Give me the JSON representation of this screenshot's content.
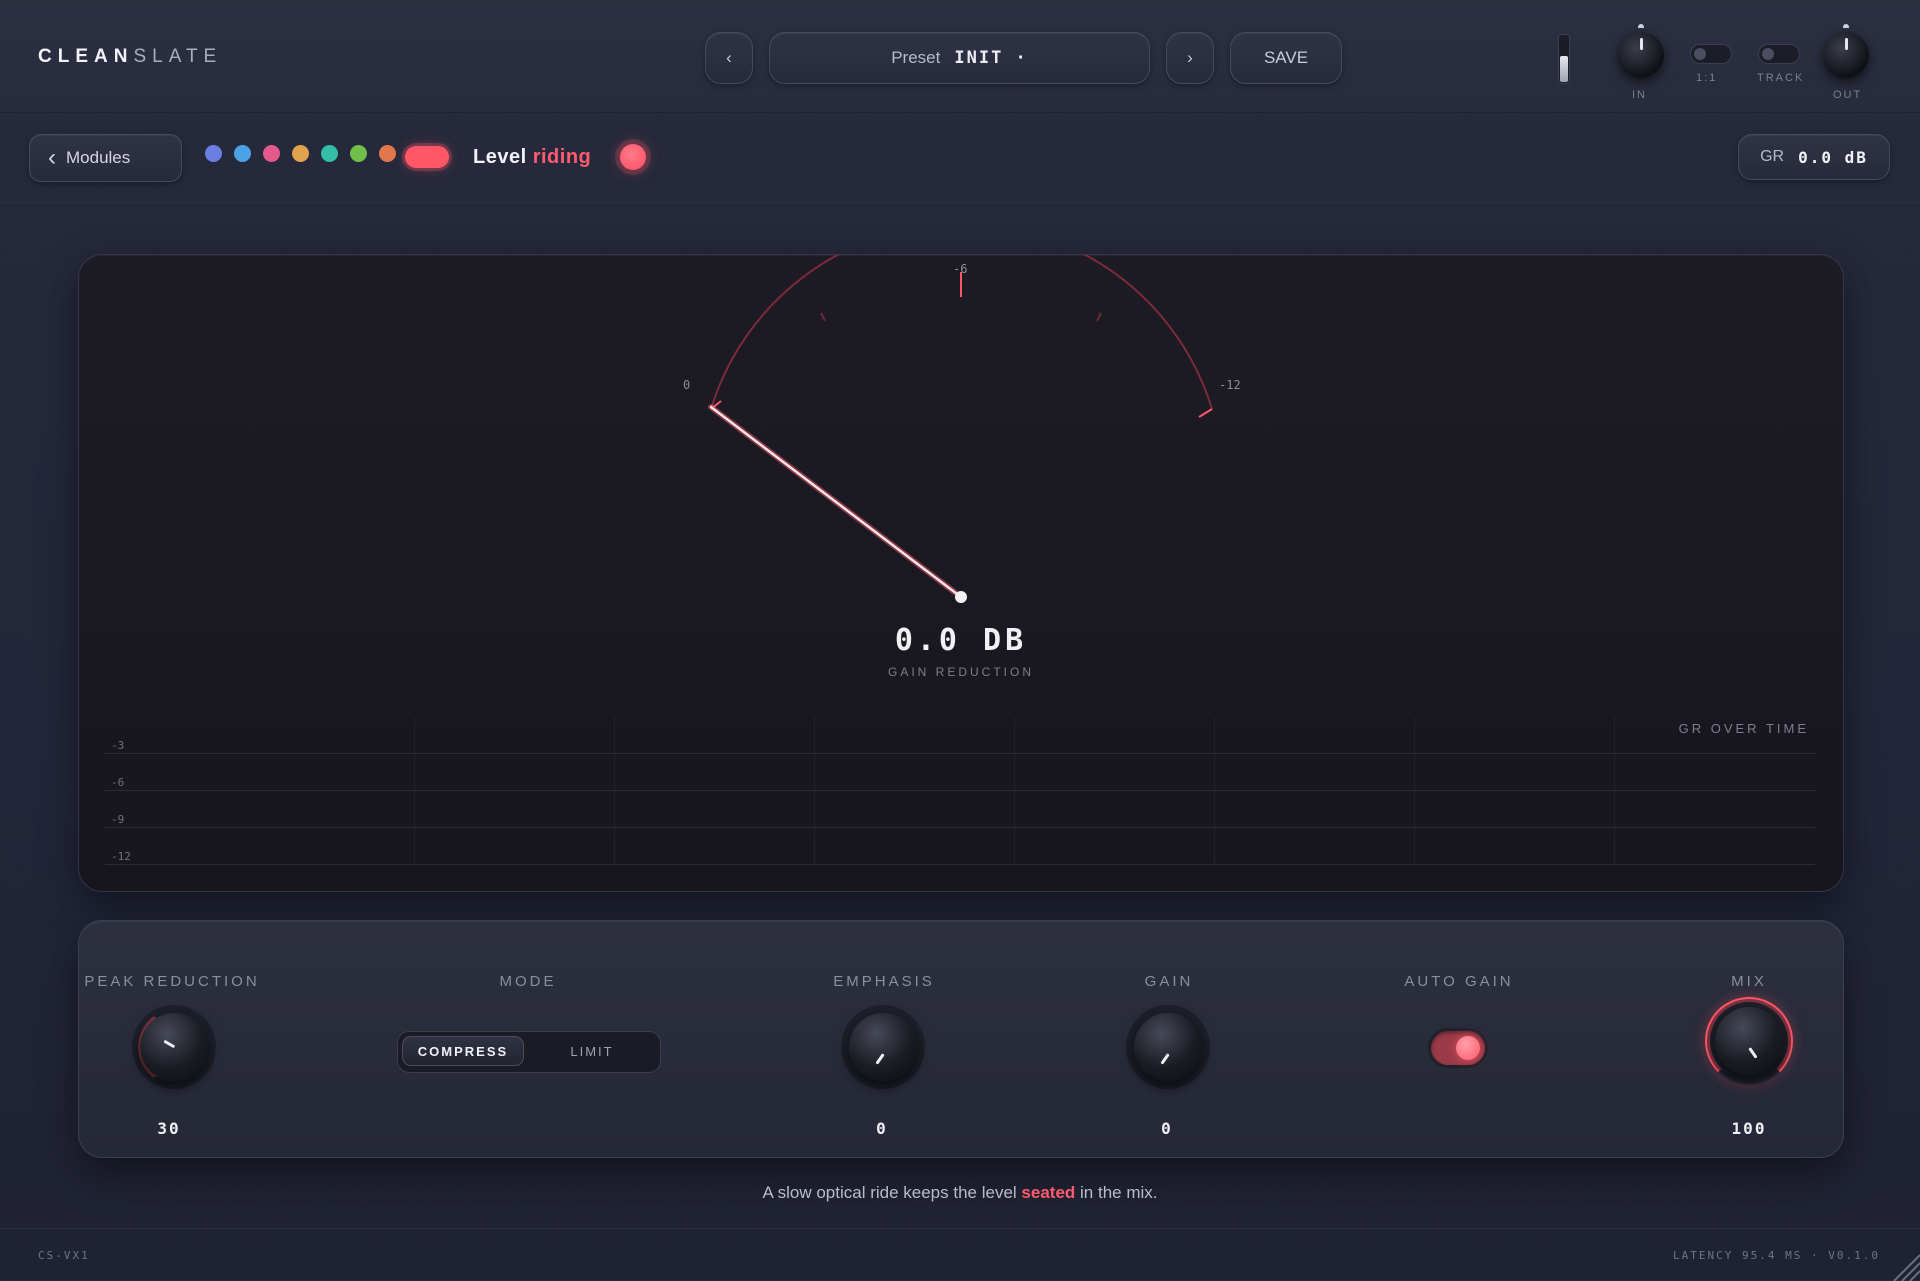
{
  "brand": {
    "bold": "CLEAN",
    "light": "SLATE"
  },
  "header": {
    "prev_label": "‹",
    "next_label": "›",
    "preset_label": "Preset",
    "preset_value": "INIT ·",
    "save_label": "SAVE",
    "input_meter_level": 0.55,
    "knob_in_label": "IN",
    "switch_ratio_label": "1:1",
    "switch_track_label": "TRACK",
    "knob_out_label": "OUT"
  },
  "modulebar": {
    "modules_label": "Modules",
    "color_dots": [
      "#6b7fe0",
      "#4ba3e6",
      "#e25a8a",
      "#e0a24c",
      "#34bda8",
      "#6fbf4a",
      "#e0784c"
    ],
    "active_color": "#ff5668",
    "title_main": "Level",
    "title_accent": "riding",
    "gr_label": "GR",
    "gr_value": "0.0 dB"
  },
  "meter": {
    "scale_left": "0",
    "scale_top": "-6",
    "scale_right": "-12",
    "readout": "0.0 DB",
    "caption": "GAIN REDUCTION",
    "accent_color": "#ff5668"
  },
  "history": {
    "title": "GR OVER TIME",
    "y_labels": [
      "-3",
      "-6",
      "-9",
      "-12"
    ]
  },
  "controls": {
    "peak_reduction": {
      "label": "PEAK REDUCTION",
      "value": "30"
    },
    "mode": {
      "label": "MODE",
      "options": [
        "COMPRESS",
        "LIMIT"
      ],
      "selected": "COMPRESS"
    },
    "emphasis": {
      "label": "EMPHASIS",
      "value": "0"
    },
    "gain": {
      "label": "GAIN",
      "value": "0"
    },
    "auto_gain": {
      "label": "AUTO GAIN",
      "on": true
    },
    "mix": {
      "label": "MIX",
      "value": "100"
    }
  },
  "tagline": {
    "before": "A slow optical ride keeps the level",
    "highlight": "seated",
    "after": "in the mix."
  },
  "footer": {
    "left": "CS-VX1",
    "right": "LATENCY 95.4 MS · V0.1.0"
  }
}
